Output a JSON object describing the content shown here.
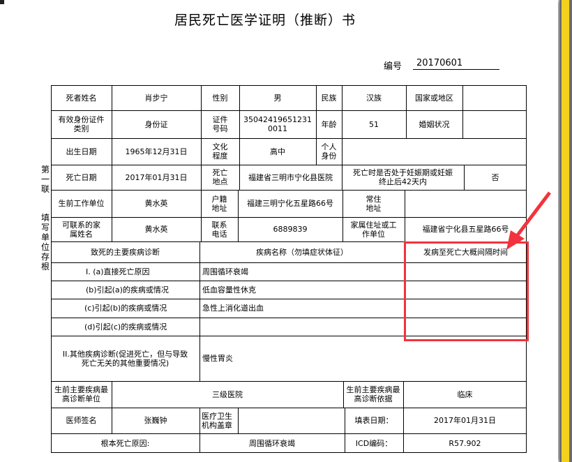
{
  "title": "居民死亡医学证明（推断）书",
  "number": {
    "label": "编号",
    "value": "20170601"
  },
  "side_label": {
    "part1": "第一联",
    "part2": "填写单位存根"
  },
  "rows": {
    "r1": {
      "name_label": "死者姓名",
      "name": "肖步宁",
      "sex_label": "性别",
      "sex": "男",
      "ethnic_label": "民族",
      "ethnic": "汉族",
      "country_label": "国家或地区",
      "country": ""
    },
    "r2": {
      "id_type_label": "有效身份证件类别",
      "id_type": "身份证",
      "id_no_label": "证件号码",
      "id_no": "350424196512310011",
      "age_label": "年龄",
      "age": "51",
      "marital_label": "婚姻状况",
      "marital": ""
    },
    "r3": {
      "birth_label": "出生日期",
      "birth": "1965年12月31日",
      "edu_label": "文化程度",
      "edu": "高中",
      "occupation_label": "个人身份",
      "occupation": ""
    },
    "r4": {
      "death_date_label": "死亡日期",
      "death_date": "2017年01月31日",
      "death_place_label": "死亡地点",
      "death_place": "福建省三明市宁化县医院",
      "pregnant_label": "死亡时是否处于妊娠期或妊娠终止后42天内",
      "pregnant": "否"
    },
    "r5": {
      "work_label": "生前工作单位",
      "work": "黄水英",
      "hukou_label": "户籍地址",
      "hukou": "福建三明宁化五星路66号",
      "residence_label": "常住地址",
      "residence": ""
    },
    "r6": {
      "contact_label": "可联系的家属姓名",
      "contact": "黄水英",
      "phone_label": "联系电话",
      "phone": "6889839",
      "family_addr_label": "家属住址或工作单位",
      "family_addr": "福建省宁化县五星路66号"
    },
    "causes": {
      "header_main": "致死的主要疾病诊断",
      "header_name": "疾病名称（勿填症状体征）",
      "header_interval": "发病至死亡大概间隔时间",
      "a_label": "I. (a)直接死亡原因",
      "a_value": "周围循环衰竭",
      "b_label": "(b)引起(a)的疾病或情况",
      "b_value": "低血容量性休克",
      "c_label": "(c)引起(b)的疾病或情况",
      "c_value": "急性上消化道出血",
      "d_label": "(d)引起(c)的疾病或情况",
      "d_value": "",
      "other_label": "II.其他疾病诊断(促进死亡，但与导致死亡无关的其他重要情况)",
      "other_value": "慢性胃炎"
    },
    "r7": {
      "hosp_label": "生前主要疾病最高诊断单位",
      "hosp": "三级医院",
      "basis_label": "生前主要疾病最高诊断依据",
      "basis": "临床"
    },
    "r8": {
      "doctor_label": "医师签名",
      "doctor": "张巍钟",
      "seal_label": "医疗卫生机构盖章",
      "date_label": "填表日期：",
      "date": "2017年01月31日"
    },
    "r9": {
      "root_label": "根本死亡原因:",
      "root": "周围循环衰竭",
      "icd_label": "ICD编码：",
      "icd": "R57.902"
    }
  },
  "colors": {
    "highlight": "#f2333d",
    "page_edge": "#f2d21f"
  }
}
